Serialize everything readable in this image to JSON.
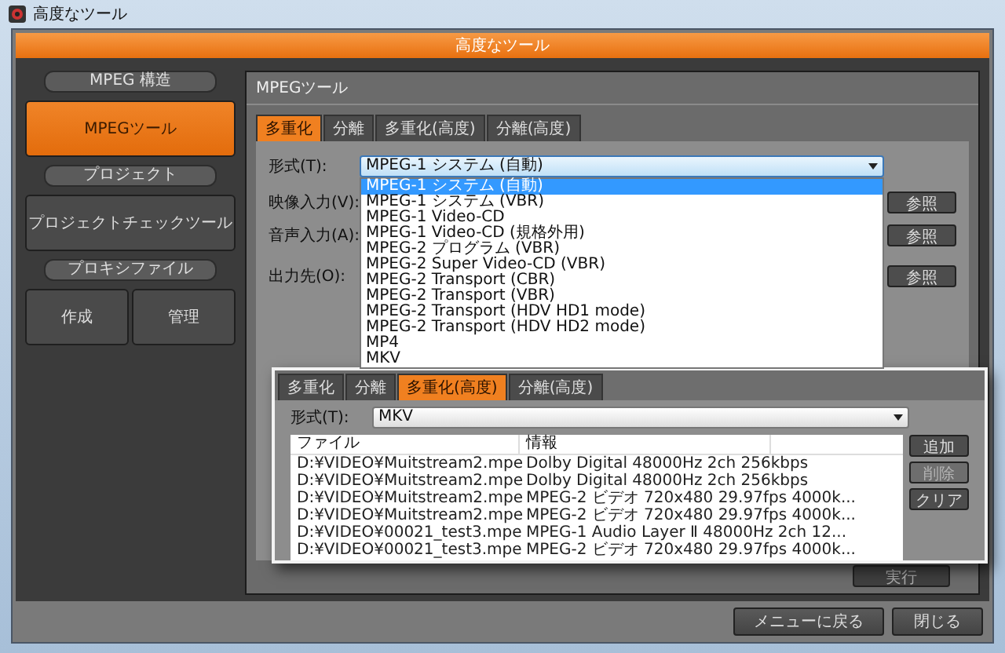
{
  "window": {
    "title": "高度なツール"
  },
  "header": {
    "title": "高度なツール"
  },
  "sidebar": {
    "sections": [
      {
        "label": "MPEG 構造",
        "buttons": [
          {
            "label": "MPEGツール",
            "selected": true
          }
        ]
      },
      {
        "label": "プロジェクト",
        "buttons": [
          {
            "label": "プロジェクトチェックツール",
            "selected": false
          }
        ]
      },
      {
        "label": "プロキシファイル",
        "buttons": [
          {
            "label": "作成",
            "selected": false
          },
          {
            "label": "管理",
            "selected": false
          }
        ]
      }
    ]
  },
  "panel": {
    "title": "MPEGツール",
    "tabs": [
      {
        "label": "多重化",
        "selected": true
      },
      {
        "label": "分離",
        "selected": false
      },
      {
        "label": "多重化(高度)",
        "selected": false
      },
      {
        "label": "分離(高度)",
        "selected": false
      }
    ],
    "format": {
      "label": "形式(T):",
      "value": "MPEG-1 システム (自動)",
      "options": [
        {
          "label": "MPEG-1 システム (自動)",
          "selected": true
        },
        {
          "label": "MPEG-1 システム (VBR)",
          "selected": false
        },
        {
          "label": "MPEG-1 Video-CD",
          "selected": false
        },
        {
          "label": "MPEG-1 Video-CD (規格外用)",
          "selected": false
        },
        {
          "label": "MPEG-2 プログラム (VBR)",
          "selected": false
        },
        {
          "label": "MPEG-2 Super Video-CD (VBR)",
          "selected": false
        },
        {
          "label": "MPEG-2 Transport (CBR)",
          "selected": false
        },
        {
          "label": "MPEG-2 Transport (VBR)",
          "selected": false
        },
        {
          "label": "MPEG-2 Transport (HDV HD1 mode)",
          "selected": false
        },
        {
          "label": "MPEG-2 Transport (HDV HD2 mode)",
          "selected": false
        },
        {
          "label": "MP4",
          "selected": false
        },
        {
          "label": "MKV",
          "selected": false
        }
      ]
    },
    "inputs": [
      {
        "label": "映像入力(V):",
        "button": "参照"
      },
      {
        "label": "音声入力(A):",
        "button": "参照"
      },
      {
        "label": "出力先(O):",
        "button": "参照"
      }
    ],
    "run_button": "実行"
  },
  "inset": {
    "tabs": [
      {
        "label": "多重化",
        "selected": false
      },
      {
        "label": "分離",
        "selected": false
      },
      {
        "label": "多重化(高度)",
        "selected": true
      },
      {
        "label": "分離(高度)",
        "selected": false
      }
    ],
    "format": {
      "label": "形式(T):",
      "value": "MKV"
    },
    "table": {
      "columns": [
        "ファイル",
        "情報"
      ],
      "rows": [
        [
          "D:¥VIDEO¥Muitstream2.mpe",
          "Dolby Digital 48000Hz 2ch 256kbps"
        ],
        [
          "D:¥VIDEO¥Muitstream2.mpe",
          "Dolby Digital 48000Hz 2ch 256kbps"
        ],
        [
          "D:¥VIDEO¥Muitstream2.mpe",
          "MPEG-2 ビデオ 720x480 29.97fps 4000k..."
        ],
        [
          "D:¥VIDEO¥Muitstream2.mpe",
          "MPEG-2 ビデオ 720x480 29.97fps 4000k..."
        ],
        [
          "D:¥VIDEO¥00021_test3.mpe",
          "MPEG-1 Audio Layer Ⅱ 48000Hz 2ch 12..."
        ],
        [
          "D:¥VIDEO¥00021_test3.mpe",
          "MPEG-2 ビデオ 720x480 29.97fps 4000k..."
        ]
      ]
    },
    "buttons": [
      {
        "label": "追加",
        "disabled": false
      },
      {
        "label": "削除",
        "disabled": true
      },
      {
        "label": "クリア",
        "disabled": false
      }
    ]
  },
  "footer": {
    "buttons": [
      "メニューに戻る",
      "閉じる"
    ]
  }
}
